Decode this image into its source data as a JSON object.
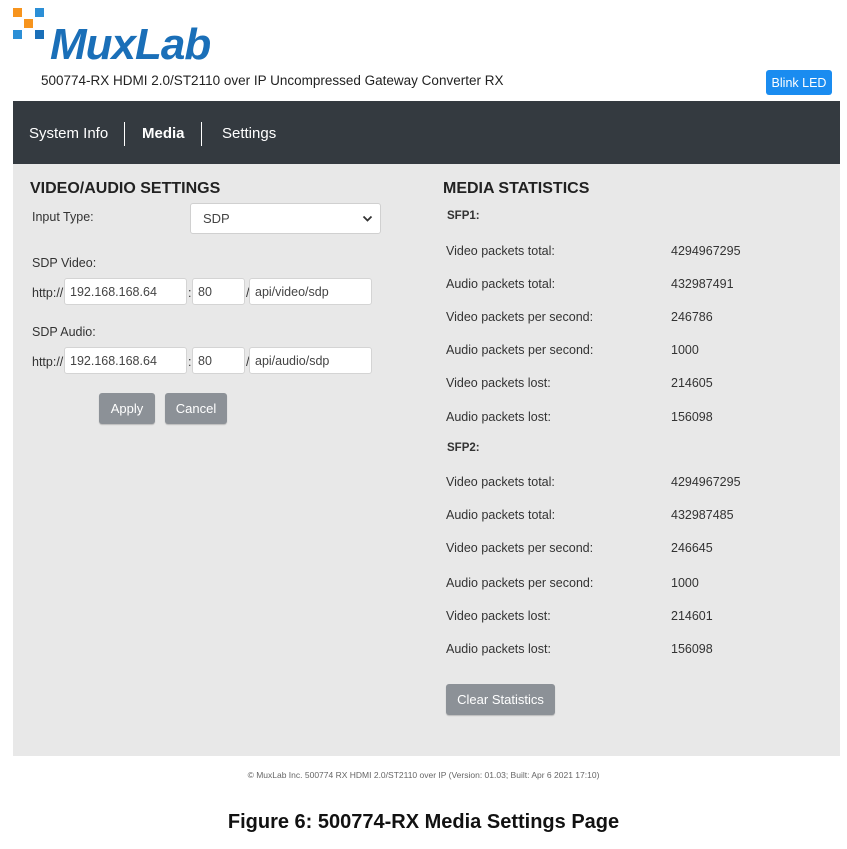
{
  "header": {
    "logo_text": "MuxLab",
    "subtitle": "500774-RX HDMI 2.0/ST2110 over IP Uncompressed Gateway Converter RX",
    "blink_led_label": "Blink LED"
  },
  "nav": {
    "items": [
      {
        "label": "System Info"
      },
      {
        "label": "Media"
      },
      {
        "label": "Settings"
      }
    ],
    "active": "Media"
  },
  "video_audio": {
    "title": "VIDEO/AUDIO SETTINGS",
    "input_type_label": "Input Type:",
    "input_type_value": "SDP",
    "sdp_video_label": "SDP Video:",
    "sdp_audio_label": "SDP Audio:",
    "prefix": "http://",
    "colon": ":",
    "slash": "/",
    "video": {
      "ip": "192.168.168.64",
      "port": "80",
      "path": "api/video/sdp"
    },
    "audio": {
      "ip": "192.168.168.64",
      "port": "80",
      "path": "api/audio/sdp"
    },
    "apply_label": "Apply",
    "cancel_label": "Cancel"
  },
  "stats": {
    "title": "MEDIA STATISTICS",
    "sfp1": {
      "label": "SFP1:",
      "rows": [
        {
          "label": "Video packets total:",
          "value": "4294967295"
        },
        {
          "label": "Audio packets total:",
          "value": "432987491"
        },
        {
          "label": "Video packets per second:",
          "value": "246786"
        },
        {
          "label": "Audio packets per second:",
          "value": "1000"
        },
        {
          "label": "Video packets lost:",
          "value": "214605"
        },
        {
          "label": "Audio packets lost:",
          "value": "156098"
        }
      ]
    },
    "sfp2": {
      "label": "SFP2:",
      "rows": [
        {
          "label": "Video packets total:",
          "value": "4294967295"
        },
        {
          "label": "Audio packets total:",
          "value": "432987485"
        },
        {
          "label": "Video packets per second:",
          "value": "246645"
        },
        {
          "label": "Audio packets per second:",
          "value": "1000"
        },
        {
          "label": "Video packets lost:",
          "value": "214601"
        },
        {
          "label": "Audio packets lost:",
          "value": "156098"
        }
      ]
    },
    "clear_label": "Clear Statistics"
  },
  "footer": "© MuxLab Inc. 500774 RX HDMI 2.0/ST2110 over IP (Version: 01.03; Built: Apr 6 2021 17:10)",
  "caption": "Figure 6: 500774-RX Media Settings Page",
  "colors": {
    "brand_blue": "#1a6fb8",
    "nav_bg": "#343a40",
    "button_blue": "#1a8cf0",
    "button_gray": "#8c9197",
    "logo_orange": "#f7941d",
    "logo_blue": "#1a6fb8"
  }
}
